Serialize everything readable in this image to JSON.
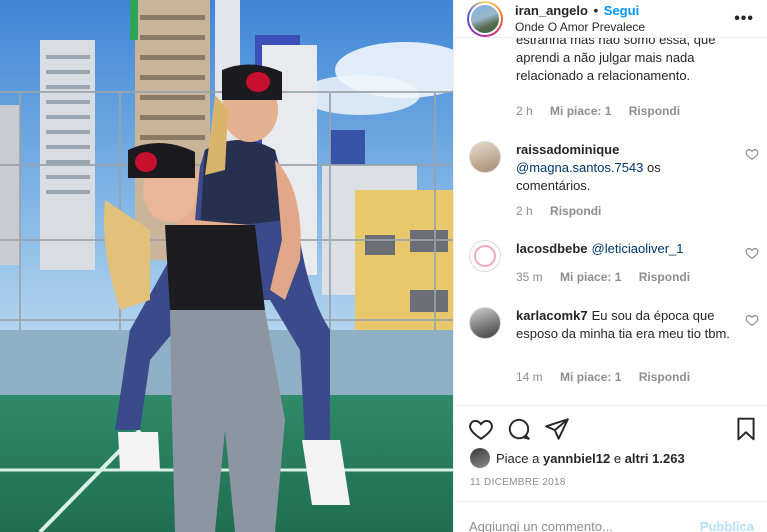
{
  "header": {
    "username": "iran_angelo",
    "separator": "•",
    "follow_label": "Segui",
    "location": "Onde O Amor Prevalece",
    "more_icon": "more-horizontal-icon"
  },
  "cut_comment": {
    "partial_line": "estranha mas não somo essa, que",
    "lines": "aprendi a não julgar mais nada relacionado a relacionamento.",
    "time": "2 h",
    "likes": "Mi piace: 1",
    "reply": "Rispondi"
  },
  "comments": [
    {
      "username": "raissadominique",
      "mention": "@magna.santos.7543",
      "text": " os comentários.",
      "time": "2 h",
      "likes": "",
      "reply": "Rispondi"
    },
    {
      "username": "lacosdbebe",
      "mention": "@leticiaoliver_1",
      "text": "",
      "time": "35 m",
      "likes": "Mi piace: 1",
      "reply": "Rispondi"
    },
    {
      "username": "karlacomk7",
      "mention": "",
      "text": "Eu sou da época que esposo da minha tia era meu tio tbm.",
      "time": "14 m",
      "likes": "Mi piace: 1",
      "reply": "Rispondi"
    }
  ],
  "actions": {
    "icons": [
      "heart-icon",
      "comment-icon",
      "share-icon",
      "bookmark-icon"
    ]
  },
  "likes": {
    "prefix": "Piace a ",
    "user": "yannbiel12",
    "middle": " e ",
    "others": "altri 1.263"
  },
  "date": "11 DICEMBRE 2018",
  "add_comment": {
    "placeholder": "Aggiungi un commento...",
    "publish_label": "Pubblica"
  },
  "colors": {
    "accent": "#0095f6",
    "publish_disabled": "#b2dffc",
    "muted": "#8e8e8e",
    "mention": "#00376b"
  }
}
